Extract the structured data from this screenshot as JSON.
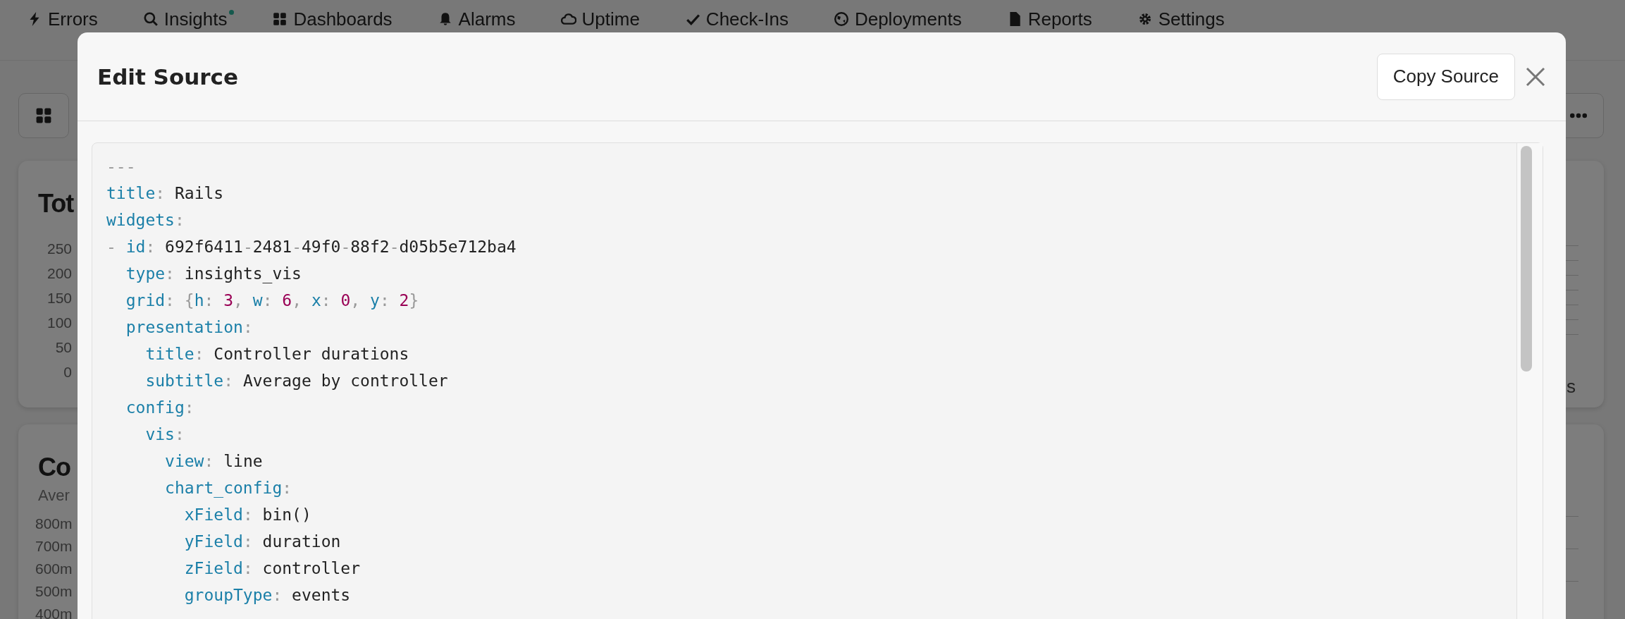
{
  "nav": {
    "items": [
      {
        "label": "Errors",
        "dot": false
      },
      {
        "label": "Insights",
        "dot": true
      },
      {
        "label": "Dashboards",
        "dot": false
      },
      {
        "label": "Alarms",
        "dot": false
      },
      {
        "label": "Uptime",
        "dot": false
      },
      {
        "label": "Check-Ins",
        "dot": false
      },
      {
        "label": "Deployments",
        "dot": false
      },
      {
        "label": "Reports",
        "dot": false
      },
      {
        "label": "Settings",
        "dot": false
      }
    ]
  },
  "background": {
    "cards": [
      {
        "title": "Tot",
        "axis": [
          "250",
          "200",
          "150",
          "100",
          "50",
          "0"
        ]
      },
      {
        "title": "Co",
        "subtitle": "Aver",
        "axis": [
          "800m",
          "700m",
          "600m",
          "500m",
          "400m"
        ]
      }
    ],
    "legend_fragment": "s"
  },
  "modal": {
    "title": "Edit Source",
    "copy_button": "Copy Source",
    "lines": [
      [
        {
          "kind": "punct",
          "text": "---"
        }
      ],
      [
        {
          "kind": "key",
          "text": "title"
        },
        {
          "kind": "punct",
          "text": ": "
        },
        {
          "kind": "value",
          "text": "Rails"
        }
      ],
      [
        {
          "kind": "key",
          "text": "widgets"
        },
        {
          "kind": "punct",
          "text": ":"
        }
      ],
      [
        {
          "kind": "punct",
          "text": "- "
        },
        {
          "kind": "key",
          "text": "id"
        },
        {
          "kind": "punct",
          "text": ": "
        },
        {
          "kind": "value",
          "text": "692f6411"
        },
        {
          "kind": "punct",
          "text": "-"
        },
        {
          "kind": "value",
          "text": "2481"
        },
        {
          "kind": "punct",
          "text": "-"
        },
        {
          "kind": "value",
          "text": "49f0"
        },
        {
          "kind": "punct",
          "text": "-"
        },
        {
          "kind": "value",
          "text": "88f2"
        },
        {
          "kind": "punct",
          "text": "-"
        },
        {
          "kind": "value",
          "text": "d05b5e712ba4"
        }
      ],
      [
        {
          "kind": "key",
          "text": "  type"
        },
        {
          "kind": "punct",
          "text": ": "
        },
        {
          "kind": "value",
          "text": "insights_vis"
        }
      ],
      [
        {
          "kind": "key",
          "text": "  grid"
        },
        {
          "kind": "punct",
          "text": ": {"
        },
        {
          "kind": "key",
          "text": "h"
        },
        {
          "kind": "punct",
          "text": ": "
        },
        {
          "kind": "number",
          "text": "3"
        },
        {
          "kind": "punct",
          "text": ", "
        },
        {
          "kind": "key",
          "text": "w"
        },
        {
          "kind": "punct",
          "text": ": "
        },
        {
          "kind": "number",
          "text": "6"
        },
        {
          "kind": "punct",
          "text": ", "
        },
        {
          "kind": "key",
          "text": "x"
        },
        {
          "kind": "punct",
          "text": ": "
        },
        {
          "kind": "number",
          "text": "0"
        },
        {
          "kind": "punct",
          "text": ", "
        },
        {
          "kind": "key",
          "text": "y"
        },
        {
          "kind": "punct",
          "text": ": "
        },
        {
          "kind": "number",
          "text": "2"
        },
        {
          "kind": "punct",
          "text": "}"
        }
      ],
      [
        {
          "kind": "key",
          "text": "  presentation"
        },
        {
          "kind": "punct",
          "text": ":"
        }
      ],
      [
        {
          "kind": "key",
          "text": "    title"
        },
        {
          "kind": "punct",
          "text": ": "
        },
        {
          "kind": "value",
          "text": "Controller durations"
        }
      ],
      [
        {
          "kind": "key",
          "text": "    subtitle"
        },
        {
          "kind": "punct",
          "text": ": "
        },
        {
          "kind": "value",
          "text": "Average by controller"
        }
      ],
      [
        {
          "kind": "key",
          "text": "  config"
        },
        {
          "kind": "punct",
          "text": ":"
        }
      ],
      [
        {
          "kind": "key",
          "text": "    vis"
        },
        {
          "kind": "punct",
          "text": ":"
        }
      ],
      [
        {
          "kind": "key",
          "text": "      view"
        },
        {
          "kind": "punct",
          "text": ": "
        },
        {
          "kind": "value",
          "text": "line"
        }
      ],
      [
        {
          "kind": "key",
          "text": "      chart_config"
        },
        {
          "kind": "punct",
          "text": ":"
        }
      ],
      [
        {
          "kind": "key",
          "text": "        xField"
        },
        {
          "kind": "punct",
          "text": ": "
        },
        {
          "kind": "value",
          "text": "bin()"
        }
      ],
      [
        {
          "kind": "key",
          "text": "        yField"
        },
        {
          "kind": "punct",
          "text": ": "
        },
        {
          "kind": "value",
          "text": "duration"
        }
      ],
      [
        {
          "kind": "key",
          "text": "        zField"
        },
        {
          "kind": "punct",
          "text": ": "
        },
        {
          "kind": "value",
          "text": "controller"
        }
      ],
      [
        {
          "kind": "key",
          "text": "        groupType"
        },
        {
          "kind": "punct",
          "text": ": "
        },
        {
          "kind": "value",
          "text": "events"
        }
      ]
    ]
  }
}
